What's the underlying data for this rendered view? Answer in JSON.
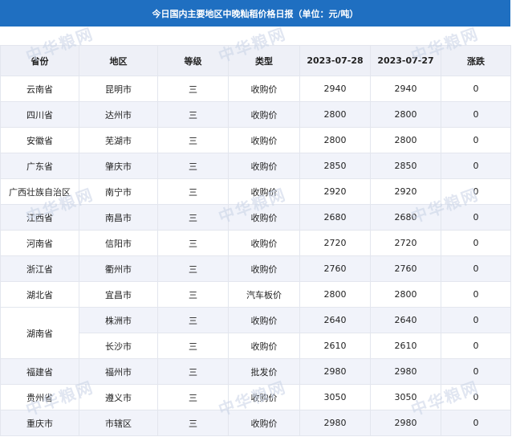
{
  "title": "今日国内主要地区中晚籼稻价格日报（单位：元/吨）",
  "watermark": "中华粮网",
  "headers": [
    "省份",
    "地区",
    "等级",
    "类型",
    "2023-07-28",
    "2023-07-27",
    "涨跌"
  ],
  "rows": [
    {
      "province": "云南省",
      "city": "昆明市",
      "grade": "三",
      "type": "收购价",
      "today": "2940",
      "prev": "2940",
      "change": "0"
    },
    {
      "province": "四川省",
      "city": "达州市",
      "grade": "三",
      "type": "收购价",
      "today": "2800",
      "prev": "2800",
      "change": "0"
    },
    {
      "province": "安徽省",
      "city": "芜湖市",
      "grade": "三",
      "type": "收购价",
      "today": "2800",
      "prev": "2800",
      "change": "0"
    },
    {
      "province": "广东省",
      "city": "肇庆市",
      "grade": "三",
      "type": "收购价",
      "today": "2850",
      "prev": "2850",
      "change": "0"
    },
    {
      "province": "广西壮族自治区",
      "city": "南宁市",
      "grade": "三",
      "type": "收购价",
      "today": "2920",
      "prev": "2920",
      "change": "0"
    },
    {
      "province": "江西省",
      "city": "南昌市",
      "grade": "三",
      "type": "收购价",
      "today": "2680",
      "prev": "2680",
      "change": "0"
    },
    {
      "province": "河南省",
      "city": "信阳市",
      "grade": "三",
      "type": "收购价",
      "today": "2720",
      "prev": "2720",
      "change": "0"
    },
    {
      "province": "浙江省",
      "city": "衢州市",
      "grade": "三",
      "type": "收购价",
      "today": "2760",
      "prev": "2760",
      "change": "0"
    },
    {
      "province": "湖北省",
      "city": "宜昌市",
      "grade": "三",
      "type": "汽车板价",
      "today": "2800",
      "prev": "2800",
      "change": "0"
    },
    {
      "province": "湖南省",
      "city": "株洲市",
      "grade": "三",
      "type": "收购价",
      "today": "2640",
      "prev": "2640",
      "change": "0"
    },
    {
      "province": "",
      "city": "长沙市",
      "grade": "三",
      "type": "收购价",
      "today": "2610",
      "prev": "2610",
      "change": "0"
    },
    {
      "province": "福建省",
      "city": "福州市",
      "grade": "三",
      "type": "批发价",
      "today": "2980",
      "prev": "2980",
      "change": "0"
    },
    {
      "province": "贵州省",
      "city": "遵义市",
      "grade": "三",
      "type": "收购价",
      "today": "3050",
      "prev": "3050",
      "change": "0"
    },
    {
      "province": "重庆市",
      "city": "市辖区",
      "grade": "三",
      "type": "收购价",
      "today": "2980",
      "prev": "2980",
      "change": "0"
    }
  ]
}
